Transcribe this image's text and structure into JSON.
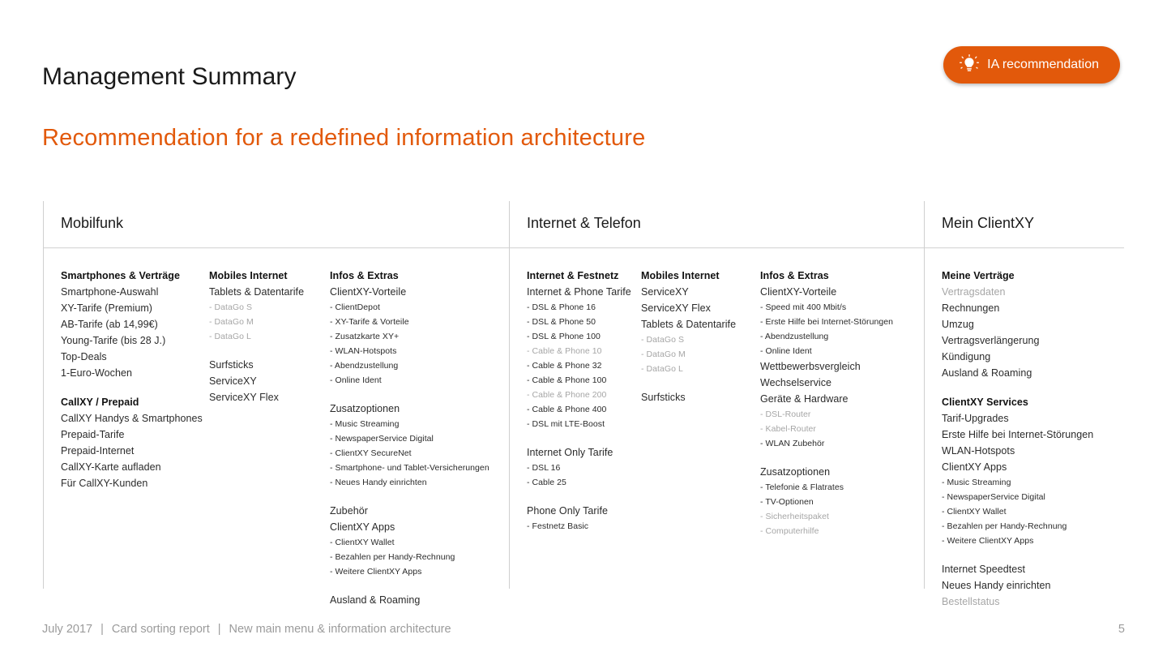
{
  "header": {
    "title": "Management Summary",
    "subtitle": "Recommendation for a redefined information architecture",
    "accent_color": "#e2590b",
    "badge": {
      "label": "IA recommendation",
      "icon": "lightbulb-icon",
      "background_color": "#e2590b",
      "text_color": "#ffffff"
    }
  },
  "footer": {
    "date": "July 2017",
    "separator": "|",
    "report": "Card sorting report",
    "subject": "New main menu & information architecture",
    "page_number": "5",
    "text_color": "#9b9b9b"
  },
  "muted_color": "#a6a6a6",
  "groups": [
    {
      "title": "Mobilfunk",
      "columns": [
        {
          "blocks": [
            {
              "entries": [
                {
                  "text": "Smartphones & Verträge",
                  "level": "cat",
                  "muted": false
                },
                {
                  "text": "Smartphone-Auswahl",
                  "level": "item",
                  "muted": false
                },
                {
                  "text": "XY-Tarife (Premium)",
                  "level": "item",
                  "muted": false
                },
                {
                  "text": "AB-Tarife (ab 14,99€)",
                  "level": "item",
                  "muted": false
                },
                {
                  "text": "Young-Tarife (bis 28 J.)",
                  "level": "item",
                  "muted": false
                },
                {
                  "text": "Top-Deals",
                  "level": "item",
                  "muted": false
                },
                {
                  "text": "1-Euro-Wochen",
                  "level": "item",
                  "muted": false
                }
              ]
            },
            {
              "entries": [
                {
                  "text": "CallXY / Prepaid",
                  "level": "cat",
                  "muted": false
                },
                {
                  "text": "CallXY Handys & Smartphones",
                  "level": "item",
                  "muted": false
                },
                {
                  "text": "Prepaid-Tarife",
                  "level": "item",
                  "muted": false
                },
                {
                  "text": "Prepaid-Internet",
                  "level": "item",
                  "muted": false
                },
                {
                  "text": "CallXY-Karte aufladen",
                  "level": "item",
                  "muted": false
                },
                {
                  "text": "Für CallXY-Kunden",
                  "level": "item",
                  "muted": false
                }
              ]
            }
          ]
        },
        {
          "blocks": [
            {
              "entries": [
                {
                  "text": "Mobiles Internet",
                  "level": "cat",
                  "muted": false
                },
                {
                  "text": "Tablets & Datentarife",
                  "level": "item",
                  "muted": false
                },
                {
                  "text": "- DataGo S",
                  "level": "sub",
                  "muted": true
                },
                {
                  "text": "- DataGo M",
                  "level": "sub",
                  "muted": true
                },
                {
                  "text": "- DataGo L",
                  "level": "sub",
                  "muted": true
                }
              ]
            },
            {
              "entries": [
                {
                  "text": "Surfsticks",
                  "level": "item",
                  "muted": false
                },
                {
                  "text": "ServiceXY",
                  "level": "item",
                  "muted": false
                },
                {
                  "text": "ServiceXY Flex",
                  "level": "item",
                  "muted": false
                }
              ]
            }
          ]
        },
        {
          "blocks": [
            {
              "entries": [
                {
                  "text": "Infos & Extras",
                  "level": "cat",
                  "muted": false
                },
                {
                  "text": "ClientXY-Vorteile",
                  "level": "item",
                  "muted": false
                },
                {
                  "text": "- ClientDepot",
                  "level": "sub",
                  "muted": false
                },
                {
                  "text": "- XY-Tarife & Vorteile",
                  "level": "sub",
                  "muted": false
                },
                {
                  "text": "- Zusatzkarte XY+",
                  "level": "sub",
                  "muted": false
                },
                {
                  "text": "- WLAN-Hotspots",
                  "level": "sub",
                  "muted": false
                },
                {
                  "text": "- Abendzustellung",
                  "level": "sub",
                  "muted": false
                },
                {
                  "text": "- Online Ident",
                  "level": "sub",
                  "muted": false
                }
              ]
            },
            {
              "entries": [
                {
                  "text": "Zusatzoptionen",
                  "level": "item",
                  "muted": false
                },
                {
                  "text": "- Music Streaming",
                  "level": "sub",
                  "muted": false
                },
                {
                  "text": "- NewspaperService Digital",
                  "level": "sub",
                  "muted": false
                },
                {
                  "text": "- ClientXY SecureNet",
                  "level": "sub",
                  "muted": false
                },
                {
                  "text": "- Smartphone- und Tablet-Versicherungen",
                  "level": "sub",
                  "muted": false
                },
                {
                  "text": "- Neues Handy einrichten",
                  "level": "sub",
                  "muted": false
                }
              ]
            },
            {
              "entries": [
                {
                  "text": "Zubehör",
                  "level": "item",
                  "muted": false
                },
                {
                  "text": "ClientXY Apps",
                  "level": "item",
                  "muted": false
                },
                {
                  "text": "- ClientXY Wallet",
                  "level": "sub",
                  "muted": false
                },
                {
                  "text": "- Bezahlen per Handy-Rechnung",
                  "level": "sub",
                  "muted": false
                },
                {
                  "text": "- Weitere ClientXY Apps",
                  "level": "sub",
                  "muted": false
                }
              ]
            },
            {
              "entries": [
                {
                  "text": "Ausland & Roaming",
                  "level": "item",
                  "muted": false
                }
              ]
            }
          ]
        }
      ]
    },
    {
      "title": "Internet & Telefon",
      "columns": [
        {
          "blocks": [
            {
              "entries": [
                {
                  "text": "Internet & Festnetz",
                  "level": "cat",
                  "muted": false
                },
                {
                  "text": "Internet & Phone Tarife",
                  "level": "item",
                  "muted": false
                },
                {
                  "text": "- DSL & Phone 16",
                  "level": "sub",
                  "muted": false
                },
                {
                  "text": "- DSL & Phone 50",
                  "level": "sub",
                  "muted": false
                },
                {
                  "text": "- DSL & Phone 100",
                  "level": "sub",
                  "muted": false
                },
                {
                  "text": "- Cable & Phone 10",
                  "level": "sub",
                  "muted": true
                },
                {
                  "text": "- Cable & Phone 32",
                  "level": "sub",
                  "muted": false
                },
                {
                  "text": "- Cable & Phone 100",
                  "level": "sub",
                  "muted": false
                },
                {
                  "text": "- Cable & Phone 200",
                  "level": "sub",
                  "muted": true
                },
                {
                  "text": "- Cable & Phone 400",
                  "level": "sub",
                  "muted": false
                },
                {
                  "text": "- DSL mit LTE-Boost",
                  "level": "sub",
                  "muted": false
                }
              ]
            },
            {
              "entries": [
                {
                  "text": "Internet Only Tarife",
                  "level": "item",
                  "muted": false
                },
                {
                  "text": "- DSL 16",
                  "level": "sub",
                  "muted": false
                },
                {
                  "text": "- Cable 25",
                  "level": "sub",
                  "muted": false
                }
              ]
            },
            {
              "entries": [
                {
                  "text": "Phone Only Tarife",
                  "level": "item",
                  "muted": false
                },
                {
                  "text": "- Festnetz Basic",
                  "level": "sub",
                  "muted": false
                }
              ]
            }
          ]
        },
        {
          "blocks": [
            {
              "entries": [
                {
                  "text": "Mobiles Internet",
                  "level": "cat",
                  "muted": false
                },
                {
                  "text": "ServiceXY",
                  "level": "item",
                  "muted": false
                },
                {
                  "text": "ServiceXY Flex",
                  "level": "item",
                  "muted": false
                },
                {
                  "text": "Tablets & Datentarife",
                  "level": "item",
                  "muted": false
                },
                {
                  "text": "- DataGo S",
                  "level": "sub",
                  "muted": true
                },
                {
                  "text": "- DataGo M",
                  "level": "sub",
                  "muted": true
                },
                {
                  "text": "- DataGo L",
                  "level": "sub",
                  "muted": true
                }
              ]
            },
            {
              "entries": [
                {
                  "text": "Surfsticks",
                  "level": "item",
                  "muted": false
                }
              ]
            }
          ]
        },
        {
          "blocks": [
            {
              "entries": [
                {
                  "text": "Infos & Extras",
                  "level": "cat",
                  "muted": false
                },
                {
                  "text": "ClientXY-Vorteile",
                  "level": "item",
                  "muted": false
                },
                {
                  "text": "- Speed mit 400 Mbit/s",
                  "level": "sub",
                  "muted": false
                },
                {
                  "text": "- Erste Hilfe bei Internet-Störungen",
                  "level": "sub",
                  "muted": false
                },
                {
                  "text": "- Abendzustellung",
                  "level": "sub",
                  "muted": false
                },
                {
                  "text": "- Online Ident",
                  "level": "sub",
                  "muted": false
                },
                {
                  "text": "Wettbewerbsvergleich",
                  "level": "item",
                  "muted": false
                },
                {
                  "text": "Wechselservice",
                  "level": "item",
                  "muted": false
                },
                {
                  "text": "Geräte & Hardware",
                  "level": "item",
                  "muted": false
                },
                {
                  "text": "- DSL-Router",
                  "level": "sub",
                  "muted": true
                },
                {
                  "text": "- Kabel-Router",
                  "level": "sub",
                  "muted": true
                },
                {
                  "text": "- WLAN Zubehör",
                  "level": "sub",
                  "muted": false
                }
              ]
            },
            {
              "entries": [
                {
                  "text": "Zusatzoptionen",
                  "level": "item",
                  "muted": false
                },
                {
                  "text": "- Telefonie & Flatrates",
                  "level": "sub",
                  "muted": false
                },
                {
                  "text": "- TV-Optionen",
                  "level": "sub",
                  "muted": false
                },
                {
                  "text": "- Sicherheitspaket",
                  "level": "sub",
                  "muted": true
                },
                {
                  "text": "- Computerhilfe",
                  "level": "sub",
                  "muted": true
                }
              ]
            }
          ]
        }
      ]
    },
    {
      "title": "Mein ClientXY",
      "columns": [
        {
          "blocks": [
            {
              "entries": [
                {
                  "text": "Meine Verträge",
                  "level": "cat",
                  "muted": false
                },
                {
                  "text": "Vertragsdaten",
                  "level": "item",
                  "muted": true
                },
                {
                  "text": "Rechnungen",
                  "level": "item",
                  "muted": false
                },
                {
                  "text": "Umzug",
                  "level": "item",
                  "muted": false
                },
                {
                  "text": "Vertragsverlängerung",
                  "level": "item",
                  "muted": false
                },
                {
                  "text": "Kündigung",
                  "level": "item",
                  "muted": false
                },
                {
                  "text": "Ausland & Roaming",
                  "level": "item",
                  "muted": false
                }
              ]
            },
            {
              "entries": [
                {
                  "text": "ClientXY Services",
                  "level": "cat",
                  "muted": false
                },
                {
                  "text": "Tarif-Upgrades",
                  "level": "item",
                  "muted": false
                },
                {
                  "text": "Erste Hilfe bei Internet-Störungen",
                  "level": "item",
                  "muted": false
                },
                {
                  "text": "WLAN-Hotspots",
                  "level": "item",
                  "muted": false
                },
                {
                  "text": "ClientXY Apps",
                  "level": "item",
                  "muted": false
                },
                {
                  "text": "- Music Streaming",
                  "level": "sub",
                  "muted": false
                },
                {
                  "text": "- NewspaperService Digital",
                  "level": "sub",
                  "muted": false
                },
                {
                  "text": "- ClientXY Wallet",
                  "level": "sub",
                  "muted": false
                },
                {
                  "text": "- Bezahlen per Handy-Rechnung",
                  "level": "sub",
                  "muted": false
                },
                {
                  "text": "- Weitere ClientXY Apps",
                  "level": "sub",
                  "muted": false
                }
              ]
            },
            {
              "entries": [
                {
                  "text": "Internet Speedtest",
                  "level": "item",
                  "muted": false
                },
                {
                  "text": "Neues Handy einrichten",
                  "level": "item",
                  "muted": false
                },
                {
                  "text": "Bestellstatus",
                  "level": "item",
                  "muted": true
                }
              ]
            }
          ]
        }
      ]
    }
  ]
}
